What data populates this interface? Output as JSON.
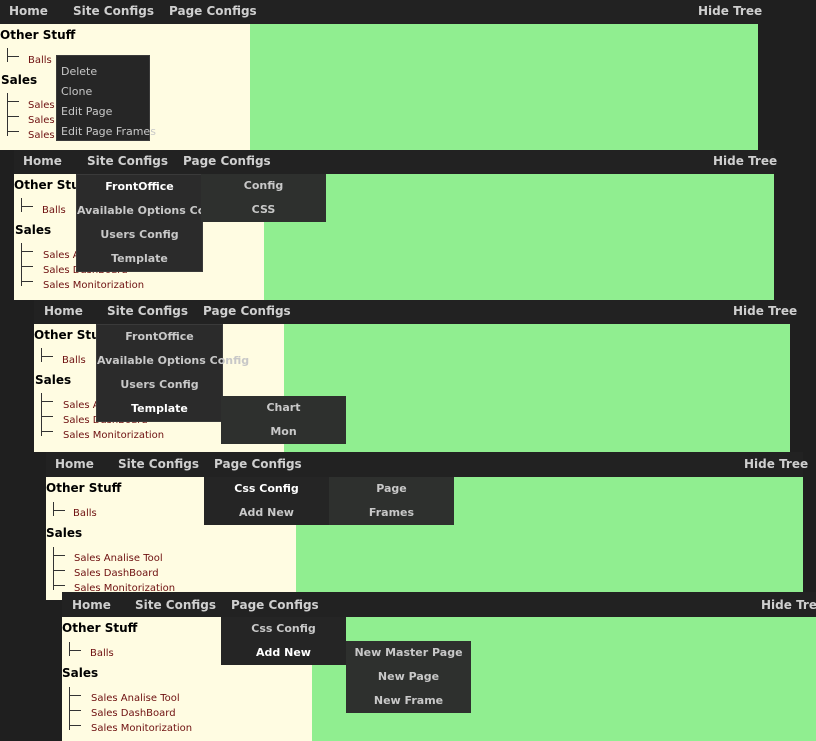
{
  "navbar": {
    "home": "Home",
    "site_configs": "Site Configs",
    "page_configs": "Page Configs",
    "hide_tree": "Hide Tree"
  },
  "tree": {
    "other_stuff": "Other Stuff",
    "balls": "Balls",
    "sales": "Sales",
    "sales_items": [
      "Sales Analise Tool",
      "Sales DashBoard",
      "Sales Monitorization"
    ],
    "sales_items_truncated": [
      "Sales",
      "Sales",
      "Sales"
    ]
  },
  "context_menu": {
    "items": [
      "Delete",
      "Clone",
      "Edit Page",
      "Edit Page Frames"
    ]
  },
  "site_configs_menu": {
    "items": [
      "FrontOffice",
      "Available Options Config",
      "Users Config",
      "Template"
    ]
  },
  "frontoffice_submenu": {
    "items": [
      "Config",
      "CSS"
    ]
  },
  "template_submenu": {
    "items": [
      "Chart",
      "Mon"
    ]
  },
  "page_configs_menu": {
    "items": [
      "Css Config",
      "Add New"
    ]
  },
  "css_config_submenu": {
    "items": [
      "Page",
      "Frames"
    ]
  },
  "add_new_submenu": {
    "items": [
      "New Master Page",
      "New Page",
      "New Frame"
    ]
  },
  "colors": {
    "navbar_bg": "#222222",
    "tree_bg": "#fffce2",
    "content_bg": "#90ee90",
    "menu_bg": "#2b2b2b",
    "leaf_text": "#6e1010"
  }
}
